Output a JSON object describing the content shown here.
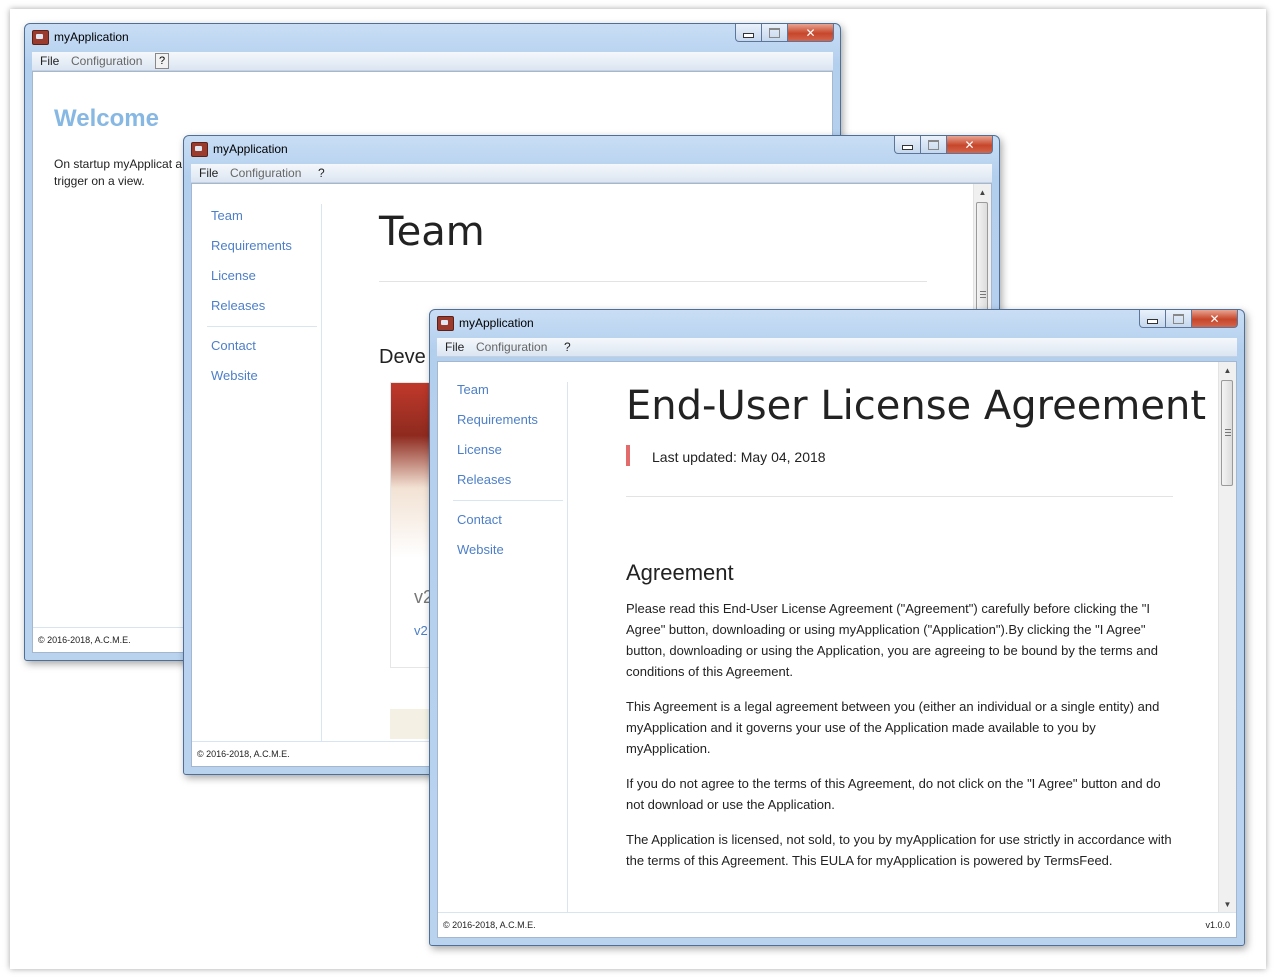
{
  "app": {
    "title": "myApplication"
  },
  "menu": {
    "file": "File",
    "configuration": "Configuration",
    "help": "?"
  },
  "window_controls": {
    "close": "✕"
  },
  "footer": {
    "copyright": "© 2016-2018, A.C.M.E.",
    "version": "v1.0.0"
  },
  "nav": {
    "items": [
      "Team",
      "Requirements",
      "License",
      "Releases"
    ],
    "extra": [
      "Contact",
      "Website"
    ]
  },
  "welcome": {
    "title": "Welcome",
    "text": "On startup myApplicat a trigger on a view."
  },
  "team": {
    "title": "Team",
    "section": "Deve",
    "card_version": "v2",
    "card_link": "v2"
  },
  "eula": {
    "title": "End-User License Agreement",
    "last_updated": "Last updated: May 04, 2018",
    "section": "Agreement",
    "paragraphs": [
      "Please read this End-User License Agreement (\"Agreement\") carefully before clicking the \"I Agree\" button, downloading or using myApplication (\"Application\").By clicking the \"I Agree\" button, downloading or using the Application, you are agreeing to be bound by the terms and conditions of this Agreement.",
      "This Agreement is a legal agreement between you (either an individual or a single entity) and myApplication and it governs your use of the Application made available to you by myApplication.",
      "If you do not agree to the terms of this Agreement, do not click on the \"I Agree\" button and do not download or use the Application.",
      "The Application is licensed, not sold, to you by myApplication for use strictly in accordance with the terms of this Agreement. This EULA for myApplication is powered by TermsFeed."
    ]
  }
}
